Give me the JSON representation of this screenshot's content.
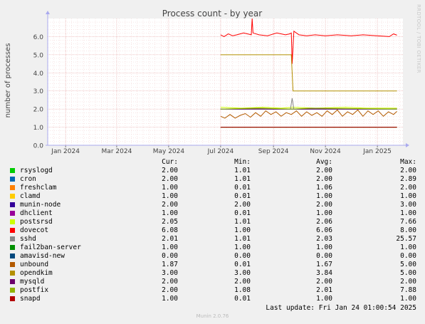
{
  "chart_data": {
    "type": "line",
    "title": "Process count - by year",
    "ylabel": "number of processes",
    "xlabel": "",
    "ylim": [
      0,
      7
    ],
    "yticks": [
      "0.0",
      "1.0",
      "2.0",
      "3.0",
      "4.0",
      "5.0",
      "6.0"
    ],
    "xlim": [
      "2023-12-11",
      "2025-01-31"
    ],
    "xticks": [
      {
        "date": "2024-01-01",
        "label": "Jan 2024"
      },
      {
        "date": "2024-03-01",
        "label": "Mar 2024"
      },
      {
        "date": "2024-05-01",
        "label": "May 2024"
      },
      {
        "date": "2024-07-01",
        "label": "Jul 2024"
      },
      {
        "date": "2024-09-01",
        "label": "Sep 2024"
      },
      {
        "date": "2024-11-01",
        "label": "Nov 2024"
      },
      {
        "date": "2025-01-01",
        "label": "Jan 2025"
      }
    ],
    "data_start": "2024-07-01",
    "data_end": "2025-01-24",
    "legend_headers": {
      "cur": "Cur:",
      "min": "Min:",
      "avg": "Avg:",
      "max": "Max:"
    },
    "series": [
      {
        "name": "rsyslogd",
        "color": "#00cc00",
        "cur": "2.00",
        "min": "1.01",
        "avg": "2.00",
        "max": "2.00",
        "points": [
          [
            "2024-07-01",
            2.0
          ],
          [
            "2025-01-24",
            2.0
          ]
        ]
      },
      {
        "name": "cron",
        "color": "#0066b3",
        "cur": "2.00",
        "min": "1.01",
        "avg": "2.00",
        "max": "2.89",
        "points": [
          [
            "2024-07-01",
            2.0
          ],
          [
            "2025-01-24",
            2.0
          ]
        ]
      },
      {
        "name": "freshclam",
        "color": "#ff8000",
        "cur": "1.00",
        "min": "0.01",
        "avg": "1.06",
        "max": "2.00",
        "points": [
          [
            "2024-07-01",
            1.0
          ],
          [
            "2025-01-24",
            1.0
          ]
        ]
      },
      {
        "name": "clamd",
        "color": "#ffcc00",
        "cur": "1.00",
        "min": "0.01",
        "avg": "1.00",
        "max": "1.00",
        "points": [
          [
            "2024-07-01",
            1.0
          ],
          [
            "2025-01-24",
            1.0
          ]
        ]
      },
      {
        "name": "munin-node",
        "color": "#330099",
        "cur": "2.00",
        "min": "2.00",
        "avg": "2.00",
        "max": "3.00",
        "points": [
          [
            "2024-07-01",
            2.0
          ],
          [
            "2025-01-24",
            2.0
          ]
        ]
      },
      {
        "name": "dhclient",
        "color": "#990099",
        "cur": "1.00",
        "min": "0.01",
        "avg": "1.00",
        "max": "1.00",
        "points": [
          [
            "2024-07-01",
            1.0
          ],
          [
            "2025-01-24",
            1.0
          ]
        ]
      },
      {
        "name": "postsrsd",
        "color": "#ccff00",
        "cur": "2.05",
        "min": "1.01",
        "avg": "2.06",
        "max": "7.66",
        "points": [
          [
            "2024-07-01",
            2.1
          ],
          [
            "2024-07-25",
            2.05
          ],
          [
            "2024-08-20",
            2.1
          ],
          [
            "2024-09-10",
            2.05
          ],
          [
            "2024-09-24",
            2.1
          ],
          [
            "2024-10-20",
            2.05
          ],
          [
            "2024-11-25",
            2.1
          ],
          [
            "2024-12-20",
            2.05
          ],
          [
            "2025-01-24",
            2.05
          ]
        ]
      },
      {
        "name": "dovecot",
        "color": "#ff0000",
        "cur": "6.08",
        "min": "1.00",
        "avg": "6.06",
        "max": "8.00",
        "points": [
          [
            "2024-07-01",
            6.1
          ],
          [
            "2024-07-05",
            6.0
          ],
          [
            "2024-07-10",
            6.15
          ],
          [
            "2024-07-15",
            6.05
          ],
          [
            "2024-07-20",
            6.1
          ],
          [
            "2024-07-28",
            6.2
          ],
          [
            "2024-08-06",
            6.1
          ],
          [
            "2024-08-07",
            7.0
          ],
          [
            "2024-08-08",
            6.2
          ],
          [
            "2024-08-15",
            6.1
          ],
          [
            "2024-08-25",
            6.05
          ],
          [
            "2024-09-05",
            6.2
          ],
          [
            "2024-09-15",
            6.1
          ],
          [
            "2024-09-20",
            6.15
          ],
          [
            "2024-09-22",
            6.2
          ],
          [
            "2024-09-23",
            4.5
          ],
          [
            "2024-09-25",
            6.3
          ],
          [
            "2024-10-01",
            6.1
          ],
          [
            "2024-10-10",
            6.05
          ],
          [
            "2024-10-20",
            6.1
          ],
          [
            "2024-11-01",
            6.05
          ],
          [
            "2024-11-15",
            6.1
          ],
          [
            "2024-12-01",
            6.05
          ],
          [
            "2024-12-15",
            6.1
          ],
          [
            "2025-01-01",
            6.05
          ],
          [
            "2025-01-15",
            6.0
          ],
          [
            "2025-01-20",
            6.15
          ],
          [
            "2025-01-24",
            6.08
          ]
        ]
      },
      {
        "name": "sshd",
        "color": "#888888",
        "cur": "2.01",
        "min": "1.01",
        "avg": "2.03",
        "max": "25.57",
        "points": [
          [
            "2024-07-01",
            2.0
          ],
          [
            "2024-09-21",
            2.0
          ],
          [
            "2024-09-23",
            2.6
          ],
          [
            "2024-09-25",
            2.0
          ],
          [
            "2025-01-24",
            2.01
          ]
        ]
      },
      {
        "name": "fail2ban-server",
        "color": "#008f00",
        "cur": "1.00",
        "min": "1.00",
        "avg": "1.00",
        "max": "1.00",
        "points": [
          [
            "2024-07-01",
            1.0
          ],
          [
            "2025-01-24",
            1.0
          ]
        ]
      },
      {
        "name": "amavisd-new",
        "color": "#00487d",
        "cur": "0.00",
        "min": "0.00",
        "avg": "0.00",
        "max": "0.00",
        "points": [
          [
            "2024-07-01",
            0.0
          ],
          [
            "2025-01-24",
            0.0
          ]
        ]
      },
      {
        "name": "unbound",
        "color": "#b35a00",
        "cur": "1.87",
        "min": "0.01",
        "avg": "1.67",
        "max": "5.00",
        "points": [
          [
            "2024-07-01",
            1.6
          ],
          [
            "2024-07-06",
            1.5
          ],
          [
            "2024-07-12",
            1.7
          ],
          [
            "2024-07-18",
            1.5
          ],
          [
            "2024-07-24",
            1.65
          ],
          [
            "2024-07-30",
            1.75
          ],
          [
            "2024-08-05",
            1.55
          ],
          [
            "2024-08-11",
            1.8
          ],
          [
            "2024-08-17",
            1.6
          ],
          [
            "2024-08-23",
            1.9
          ],
          [
            "2024-08-29",
            1.7
          ],
          [
            "2024-09-04",
            1.85
          ],
          [
            "2024-09-10",
            1.6
          ],
          [
            "2024-09-16",
            1.8
          ],
          [
            "2024-09-22",
            1.7
          ],
          [
            "2024-09-28",
            1.9
          ],
          [
            "2024-10-04",
            1.6
          ],
          [
            "2024-10-10",
            1.85
          ],
          [
            "2024-10-16",
            1.65
          ],
          [
            "2024-10-22",
            1.8
          ],
          [
            "2024-10-28",
            1.6
          ],
          [
            "2024-11-03",
            1.9
          ],
          [
            "2024-11-09",
            1.7
          ],
          [
            "2024-11-15",
            1.95
          ],
          [
            "2024-11-21",
            1.6
          ],
          [
            "2024-11-27",
            1.85
          ],
          [
            "2024-12-03",
            1.7
          ],
          [
            "2024-12-09",
            1.95
          ],
          [
            "2024-12-15",
            1.6
          ],
          [
            "2024-12-21",
            1.9
          ],
          [
            "2024-12-27",
            1.7
          ],
          [
            "2025-01-02",
            1.9
          ],
          [
            "2025-01-08",
            1.6
          ],
          [
            "2025-01-14",
            1.85
          ],
          [
            "2025-01-20",
            1.7
          ],
          [
            "2025-01-24",
            1.87
          ]
        ]
      },
      {
        "name": "opendkim",
        "color": "#b38f00",
        "cur": "3.00",
        "min": "3.00",
        "avg": "3.84",
        "max": "5.00",
        "points": [
          [
            "2024-07-01",
            5.0
          ],
          [
            "2024-09-22",
            5.0
          ],
          [
            "2024-09-24",
            3.0
          ],
          [
            "2025-01-24",
            3.0
          ]
        ]
      },
      {
        "name": "mysqld",
        "color": "#6b006b",
        "cur": "2.00",
        "min": "2.00",
        "avg": "2.00",
        "max": "2.00",
        "points": [
          [
            "2024-07-01",
            2.0
          ],
          [
            "2025-01-24",
            2.0
          ]
        ]
      },
      {
        "name": "postfix",
        "color": "#8fb300",
        "cur": "2.00",
        "min": "1.08",
        "avg": "2.01",
        "max": "7.88",
        "points": [
          [
            "2024-07-01",
            2.0
          ],
          [
            "2024-08-15",
            2.05
          ],
          [
            "2024-09-23",
            2.0
          ],
          [
            "2024-10-15",
            2.05
          ],
          [
            "2025-01-24",
            2.0
          ]
        ]
      },
      {
        "name": "snapd",
        "color": "#b30000",
        "cur": "1.00",
        "min": "0.01",
        "avg": "1.00",
        "max": "1.00",
        "points": [
          [
            "2024-07-01",
            1.0
          ],
          [
            "2025-01-24",
            1.0
          ]
        ]
      }
    ]
  },
  "last_update": "Last update: Fri Jan 24 01:00:54 2025",
  "footer": "Munin 2.0.76",
  "watermark": "RRDTOOL / TOBI OETIKER"
}
